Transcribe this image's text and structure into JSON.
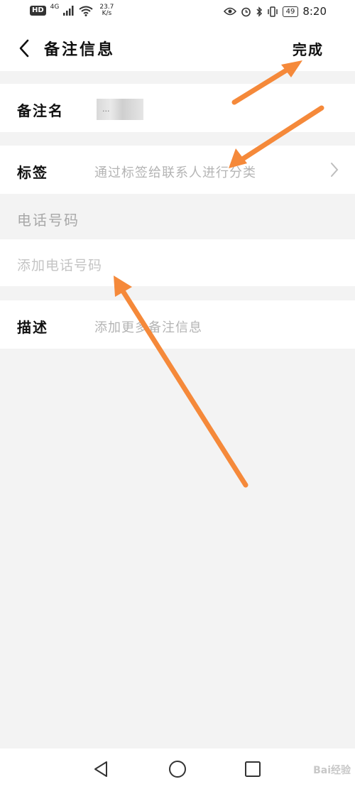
{
  "status_bar": {
    "hd": "HD",
    "net_type": "4G",
    "speed_value": "23.7",
    "speed_unit": "K/s",
    "battery": "49",
    "time": "8:20"
  },
  "header": {
    "title": "备注信息",
    "done_label": "完成"
  },
  "fields": {
    "remark_name_label": "备注名",
    "remark_name_value": "...",
    "tags_label": "标签",
    "tags_placeholder": "通过标签给联系人进行分类",
    "phone_section_label": "电话号码",
    "add_phone_placeholder": "添加电话号码",
    "description_label": "描述",
    "description_placeholder": "添加更多备注信息"
  },
  "watermark": "Bai经验",
  "colors": {
    "arrow": "#f5893a",
    "background": "#f3f3f3",
    "placeholder": "#b4b4b4"
  }
}
